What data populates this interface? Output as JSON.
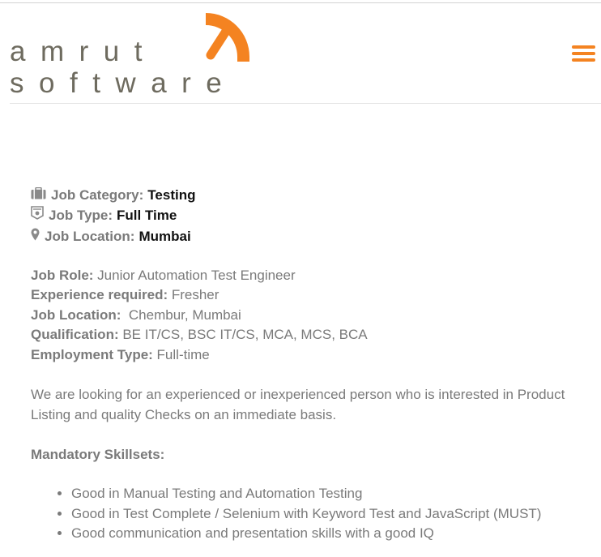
{
  "header": {
    "logo_line1": "amrut",
    "logo_line2": "software",
    "menu_icon": "hamburger-menu-icon",
    "accent_color": "#f48321"
  },
  "job_meta": [
    {
      "icon": "briefcase-icon",
      "label": "Job Category:",
      "value": "Testing"
    },
    {
      "icon": "badge-icon",
      "label": "Job Type:",
      "value": "Full Time"
    },
    {
      "icon": "location-pin-icon",
      "label": "Job Location:",
      "value": "Mumbai"
    }
  ],
  "details": [
    {
      "label": "Job Role:",
      "value": " Junior Automation Test Engineer"
    },
    {
      "label": "Experience required:",
      "value": " Fresher"
    },
    {
      "label": "Job Location:",
      "value": "  Chembur, Mumbai"
    },
    {
      "label": "Qualification:",
      "value": " BE IT/CS, BSC IT/CS, MCA, MCS, BCA"
    },
    {
      "label": "Employment Type:",
      "value": " Full-time"
    }
  ],
  "intro": "We are looking for an experienced or inexperienced person who is interested in Product Listing and quality Checks on an immediate basis.",
  "skills_heading": "Mandatory Skillsets:",
  "skills": [
    "Good in Manual Testing and Automation Testing",
    "Good in Test Complete / Selenium with Keyword Test and JavaScript (MUST)",
    "Good communication and presentation skills with a good IQ"
  ]
}
